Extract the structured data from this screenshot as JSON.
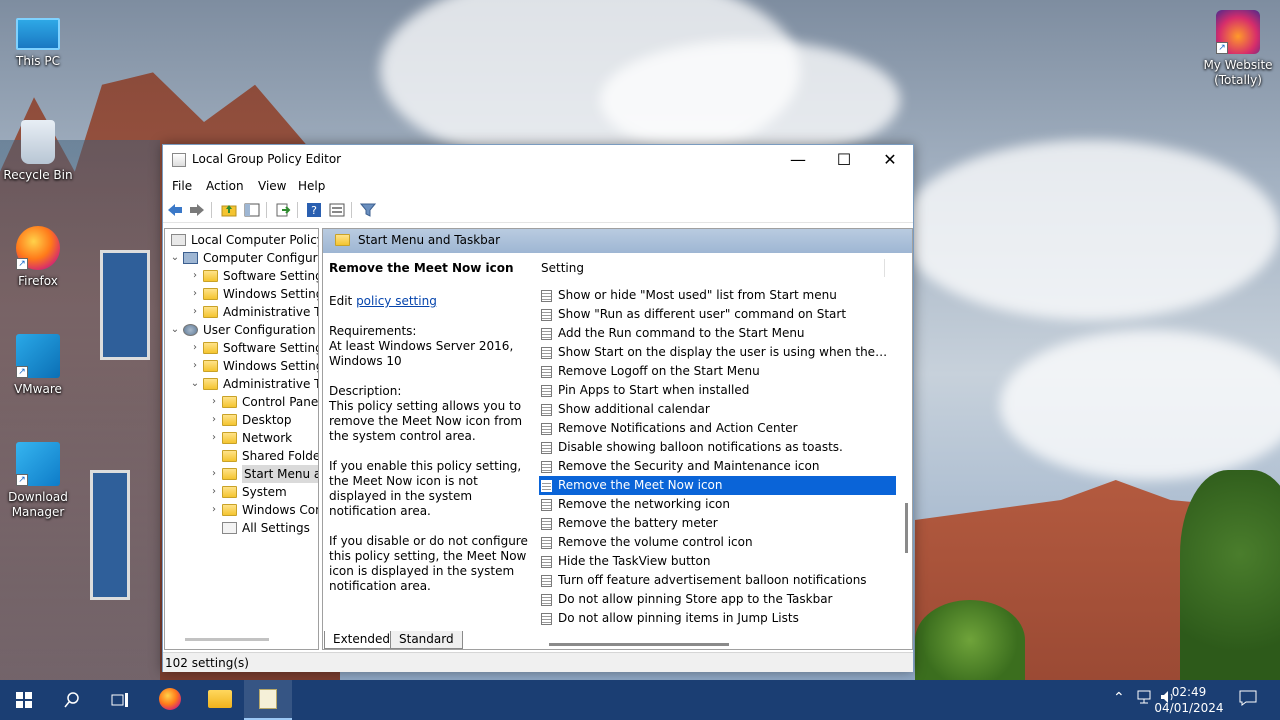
{
  "desktop": {
    "icons": [
      {
        "label": "This PC",
        "icon": "computer-icon"
      },
      {
        "label": "Recycle Bin",
        "icon": "recycle-bin-icon"
      },
      {
        "label": "Firefox",
        "icon": "firefox-icon"
      },
      {
        "label": "VMware",
        "icon": "vmware-icon"
      },
      {
        "label": "Download Manager",
        "icon": "download-manager-icon"
      },
      {
        "label": "My Website (Totally)",
        "icon": "firefox-shortcut-icon"
      }
    ]
  },
  "window": {
    "title": "Local Group Policy Editor",
    "controls": {
      "minimize": "—",
      "maximize": "☐",
      "close": "✕"
    },
    "menu": [
      "File",
      "Action",
      "View",
      "Help"
    ],
    "tree": [
      {
        "label": "Local Computer Policy",
        "level": 0,
        "chevron": ""
      },
      {
        "label": "Computer Configuration",
        "level": 0,
        "chevron": "⌄"
      },
      {
        "label": "Software Settings",
        "level": 1,
        "chevron": "›"
      },
      {
        "label": "Windows Settings",
        "level": 1,
        "chevron": "›"
      },
      {
        "label": "Administrative Templates",
        "level": 1,
        "chevron": "›"
      },
      {
        "label": "User Configuration",
        "level": 0,
        "chevron": "⌄"
      },
      {
        "label": "Software Settings",
        "level": 1,
        "chevron": "›"
      },
      {
        "label": "Windows Settings",
        "level": 1,
        "chevron": "›"
      },
      {
        "label": "Administrative Templates",
        "level": 1,
        "chevron": "⌄"
      },
      {
        "label": "Control Panel",
        "level": 2,
        "chevron": "›"
      },
      {
        "label": "Desktop",
        "level": 2,
        "chevron": "›"
      },
      {
        "label": "Network",
        "level": 2,
        "chevron": "›"
      },
      {
        "label": "Shared Folders",
        "level": 2,
        "chevron": ""
      },
      {
        "label": "Start Menu and Taskbar",
        "level": 2,
        "chevron": "›"
      },
      {
        "label": "System",
        "level": 2,
        "chevron": "›"
      },
      {
        "label": "Windows Components",
        "level": 2,
        "chevron": "›"
      },
      {
        "label": "All Settings",
        "level": 2,
        "chevron": ""
      }
    ],
    "pane_header": "Start Menu and Taskbar",
    "description": {
      "heading": "Remove the Meet Now icon",
      "edit_prefix": "Edit ",
      "edit_link": "policy setting",
      "requirements_label": "Requirements:",
      "requirements_text": "At least Windows Server 2016, Windows 10",
      "description_label": "Description:",
      "description_text": "This policy setting allows you to remove the Meet Now icon from the system control area.",
      "enable_text": "If you enable this policy setting, the Meet Now icon is not displayed in the system notification area.",
      "disable_text": "If you disable or do not configure this policy setting, the Meet Now icon is displayed in the system notification area."
    },
    "list": {
      "column": "Setting",
      "selected_index": 10,
      "rows": [
        "Show or hide \"Most used\" list from Start menu",
        "Show \"Run as different user\" command on Start",
        "Add the Run command to the Start Menu",
        "Show Start on the display the user is using when they press the Windows logo key",
        "Remove Logoff on the Start Menu",
        "Pin Apps to Start when installed",
        "Show additional calendar",
        "Remove Notifications and Action Center",
        "Disable showing balloon notifications as toasts.",
        "Remove the Security and Maintenance icon",
        "Remove the Meet Now icon",
        "Remove the networking icon",
        "Remove the battery meter",
        "Remove the volume control icon",
        "Hide the TaskView button",
        "Turn off feature advertisement balloon notifications",
        "Do not allow pinning Store app to the Taskbar",
        "Do not allow pinning items in Jump Lists"
      ]
    },
    "tabs": [
      "Extended",
      "Standard"
    ],
    "status": "102 setting(s)"
  },
  "taskbar": {
    "time": "02:49",
    "date": "04/01/2024"
  }
}
